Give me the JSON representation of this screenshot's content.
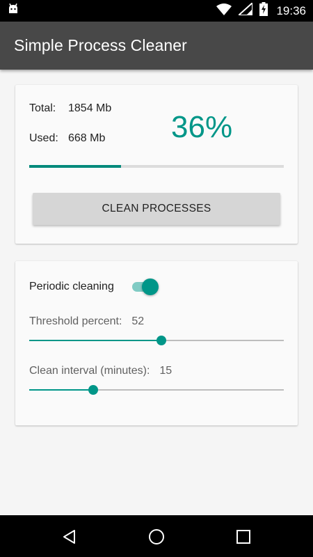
{
  "status_bar": {
    "time": "19:36"
  },
  "app_bar": {
    "title": "Simple Process Cleaner"
  },
  "memory": {
    "total_label": "Total:",
    "total_value": "1854 Mb",
    "used_label": "Used:",
    "used_value": "668 Mb",
    "percent_text": "36%",
    "usage_fraction": 0.36,
    "clean_button_label": "CLEAN PROCESSES"
  },
  "settings": {
    "periodic_label": "Periodic cleaning",
    "periodic_enabled": true,
    "threshold_label": "Threshold percent:",
    "threshold_value": "52",
    "threshold_fraction": 0.52,
    "interval_label": "Clean interval (minutes):",
    "interval_value": "15",
    "interval_fraction": 0.25
  },
  "colors": {
    "accent": "#009688",
    "app_bar": "#484848"
  },
  "icons": {
    "status_left": "android-icon",
    "status_right": [
      "wifi-icon",
      "signal-icon",
      "battery-charging-icon"
    ],
    "nav": [
      "back-icon",
      "home-icon",
      "recents-icon"
    ]
  }
}
